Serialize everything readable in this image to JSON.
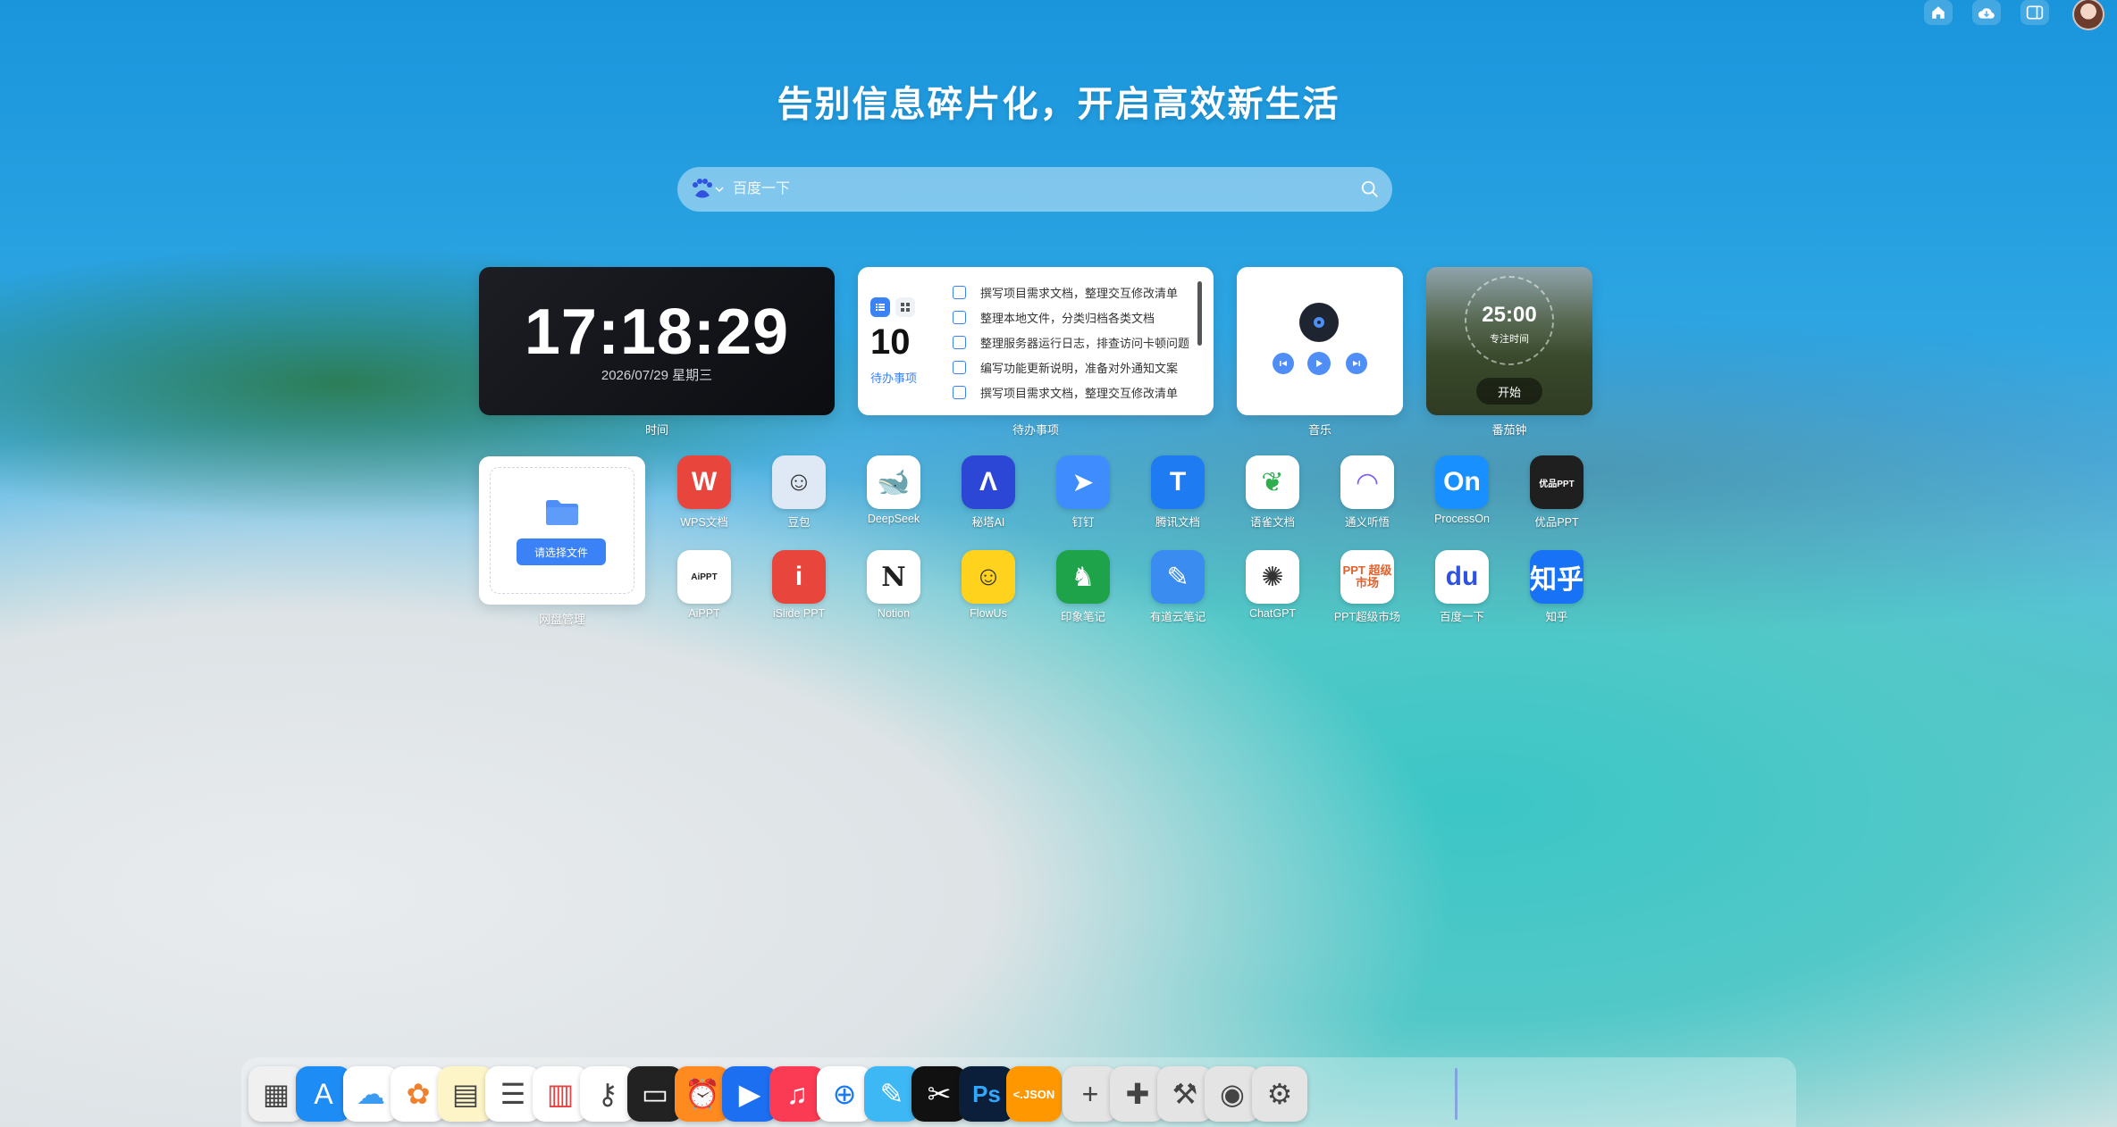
{
  "headline": "告别信息碎片化，开启高效新生活",
  "search": {
    "placeholder": "百度一下"
  },
  "clock": {
    "time": "17:18:29",
    "date": "2026/07/29 星期三",
    "label": "时间"
  },
  "todo": {
    "count": "10",
    "count_label": "待办事项",
    "label": "待办事项",
    "items": [
      "撰写项目需求文档，整理交互修改清单",
      "整理本地文件，分类归档各类文档",
      "整理服务器运行日志，排查访问卡顿问题",
      "编写功能更新说明，准备对外通知文案",
      "撰写项目需求文档，整理交互修改清单"
    ]
  },
  "music": {
    "label": "音乐"
  },
  "focus": {
    "time": "25:00",
    "subtitle": "专注时间",
    "start": "开始",
    "label": "番茄钟"
  },
  "disk": {
    "button": "请选择文件",
    "label": "网盘管理"
  },
  "apps": [
    {
      "name": "WPS文档",
      "icon": "wps-icon",
      "bg": "#e8453c"
    },
    {
      "name": "豆包",
      "icon": "doubao-icon",
      "bg": "#dfe9f5"
    },
    {
      "name": "DeepSeek",
      "icon": "deepseek-icon",
      "bg": "#ffffff"
    },
    {
      "name": "秘塔AI",
      "icon": "metaso-icon",
      "bg": "#2c47d6"
    },
    {
      "name": "钉钉",
      "icon": "dingtalk-icon",
      "bg": "#3f8cff"
    },
    {
      "name": "腾讯文档",
      "icon": "tencent-docs-icon",
      "bg": "#1e7bf2"
    },
    {
      "name": "语雀文档",
      "icon": "yuque-icon",
      "bg": "#ffffff"
    },
    {
      "name": "通义听悟",
      "icon": "tingwu-icon",
      "bg": "#ffffff"
    },
    {
      "name": "ProcessOn",
      "icon": "processon-icon",
      "bg": "#1890ff",
      "text": "On"
    },
    {
      "name": "优品PPT",
      "icon": "youpin-ppt-icon",
      "bg": "#1f1f1f",
      "text": "优品PPT"
    },
    {
      "name": "AiPPT",
      "icon": "aippt-icon",
      "bg": "#ffffff",
      "text": "AiPPT"
    },
    {
      "name": "iSlide PPT",
      "icon": "islide-icon",
      "bg": "#e8453c"
    },
    {
      "name": "Notion",
      "icon": "notion-icon",
      "bg": "#ffffff",
      "text": "N"
    },
    {
      "name": "FlowUs",
      "icon": "flowus-icon",
      "bg": "#ffd21e"
    },
    {
      "name": "印象笔记",
      "icon": "evernote-icon",
      "bg": "#1ea24a"
    },
    {
      "name": "有道云笔记",
      "icon": "youdao-note-icon",
      "bg": "#3b8cf0"
    },
    {
      "name": "ChatGPT",
      "icon": "chatgpt-icon",
      "bg": "#ffffff"
    },
    {
      "name": "PPT超级市场",
      "icon": "ppt-market-icon",
      "bg": "#ffffff",
      "text": "PPT 超级市场"
    },
    {
      "name": "百度一下",
      "icon": "baidu-icon",
      "bg": "#ffffff",
      "text": "du"
    },
    {
      "name": "知乎",
      "icon": "zhihu-icon",
      "bg": "#1772f6",
      "text": "知乎"
    }
  ],
  "dock": [
    {
      "icon": "launchpad-icon",
      "bg": "#f0f0f0"
    },
    {
      "icon": "app-store-icon",
      "bg": "#1e8cf5"
    },
    {
      "icon": "icloud-icon",
      "bg": "#ffffff"
    },
    {
      "icon": "photos-icon",
      "bg": "#ffffff"
    },
    {
      "icon": "notes-icon",
      "bg": "#fdf5c8"
    },
    {
      "icon": "reminders-icon",
      "bg": "#ffffff"
    },
    {
      "icon": "calendar-icon",
      "bg": "#ffffff"
    },
    {
      "icon": "passwords-icon",
      "bg": "#ffffff"
    },
    {
      "icon": "wallet-icon",
      "bg": "#222222"
    },
    {
      "icon": "clock-alarm-icon",
      "bg": "#ff8a1f"
    },
    {
      "icon": "video-player-icon",
      "bg": "#1d6ff2"
    },
    {
      "icon": "music-icon",
      "bg": "#fb3b53"
    },
    {
      "icon": "safari-icon",
      "bg": "#ffffff"
    },
    {
      "icon": "freeform-icon",
      "bg": "#3db8f5"
    },
    {
      "icon": "capcut-icon",
      "bg": "#111111"
    },
    {
      "icon": "photoshop-icon",
      "bg": "#0b1f3a",
      "text": "Ps"
    },
    {
      "icon": "json-icon",
      "bg": "#ff9800",
      "text": "<.JSON"
    },
    {
      "icon": "add-icon",
      "bg": "#e4e4e4"
    },
    {
      "icon": "plugin-icon",
      "bg": "#e4e4e4"
    },
    {
      "icon": "theme-brush-icon",
      "bg": "#e4e4e4"
    },
    {
      "icon": "privacy-icon",
      "bg": "#e4e4e4"
    },
    {
      "icon": "settings-icon",
      "bg": "#e4e4e4"
    }
  ]
}
